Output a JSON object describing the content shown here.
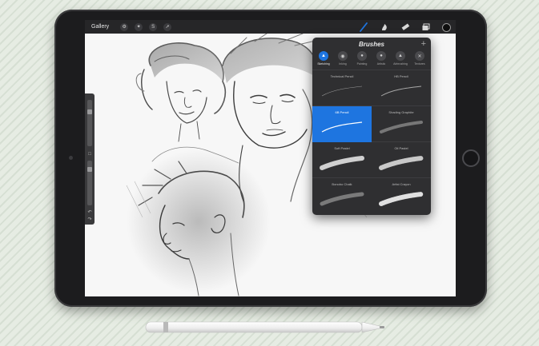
{
  "toolbar": {
    "gallery_label": "Gallery",
    "tools_left": [
      "wrench-icon",
      "magic-wand-icon",
      "selection-s-icon",
      "transform-arrow-icon"
    ],
    "tools_right": [
      "brush-icon",
      "smudge-icon",
      "eraser-icon",
      "layers-icon",
      "color-swatch"
    ],
    "current_color": "#0e0e0e"
  },
  "brushes": {
    "title": "Brushes",
    "add_label": "+",
    "categories": [
      {
        "label": "Sketching",
        "active": true
      },
      {
        "label": "Inking",
        "active": false
      },
      {
        "label": "Painting",
        "active": false
      },
      {
        "label": "Artistic",
        "active": false
      },
      {
        "label": "Airbrushing",
        "active": false
      },
      {
        "label": "Textures",
        "active": false
      }
    ],
    "items": [
      {
        "name": "Technical Pencil",
        "selected": false
      },
      {
        "name": "HB Pencil",
        "selected": false
      },
      {
        "name": "6B Pencil",
        "selected": true
      },
      {
        "name": "Shading Graphite",
        "selected": false
      },
      {
        "name": "Soft Pastel",
        "selected": false
      },
      {
        "name": "Oil Pastel",
        "selected": false
      },
      {
        "name": "Bonobo Chalk",
        "selected": false
      },
      {
        "name": "Artist Crayon",
        "selected": false
      }
    ]
  },
  "colors": {
    "accent": "#1e75e0",
    "panel": "#2f2f31",
    "toolbar": "#262628"
  }
}
